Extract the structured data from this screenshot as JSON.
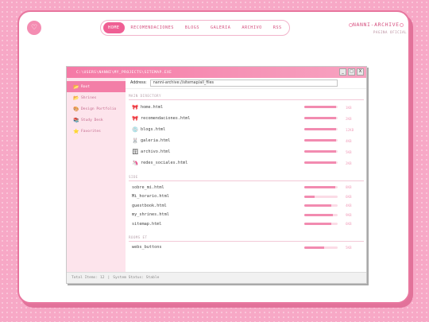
{
  "header": {
    "logo_glyph": "♡",
    "nav": [
      "HOME",
      "RECOMENDACIONES",
      "BLOGS",
      "GALERIA",
      "ARCHIVO",
      "RSS"
    ],
    "active_nav": "HOME",
    "site_title": "NANNI-ARCHIVE",
    "site_subtitle": "PAGINA OFICIAL"
  },
  "window": {
    "title_path": "C:\\USERS\\NANNI\\MY_PROJECTS\\SITEMAP.EXE",
    "buttons": [
      "_",
      "□",
      "X"
    ],
    "address_label": "Address:",
    "address_value": "nanni-archive://sitemap/all_files"
  },
  "sidebar": {
    "items": [
      {
        "icon": "📂",
        "label": "Root",
        "active": true
      },
      {
        "icon": "📂",
        "label": "Shrines",
        "active": false
      },
      {
        "icon": "🎨",
        "label": "Design Portfolio",
        "active": false
      },
      {
        "icon": "📚",
        "label": "Study Desk",
        "active": false
      },
      {
        "icon": "⭐",
        "label": "Favorites",
        "active": false
      }
    ]
  },
  "sections": [
    {
      "label": "MAIN DIRECTORY",
      "files": [
        {
          "icon": "🎀",
          "name": "home.html",
          "size": "1KB",
          "fill": 0.95
        },
        {
          "icon": "🎀",
          "name": "recomendaciones.html",
          "size": "2KB",
          "fill": 0.95
        },
        {
          "icon": "💿",
          "name": "blogs.html",
          "size": "12KB",
          "fill": 0.95
        },
        {
          "icon": "🐰",
          "name": "galeria.html",
          "size": "4KB",
          "fill": 0.95
        },
        {
          "icon": "🗄",
          "name": "archivo.html",
          "size": "5KB",
          "fill": 0.95
        },
        {
          "icon": "🦄",
          "name": "redes_sociales.html",
          "size": "2KB",
          "fill": 0.95
        }
      ]
    },
    {
      "label": "SIDE",
      "files": [
        {
          "icon": "",
          "name": "sobre_mi.html",
          "size": "8KB",
          "fill": 0.92
        },
        {
          "icon": "",
          "name": "Mi_horario.html",
          "size": "6KB",
          "fill": 0.3
        },
        {
          "icon": "",
          "name": "guestbook.html",
          "size": "4KB",
          "fill": 0.8
        },
        {
          "icon": "",
          "name": "my_shrines.html",
          "size": "9KB",
          "fill": 0.85
        },
        {
          "icon": "",
          "name": "sitemap.html",
          "size": "6KB",
          "fill": 0.8
        }
      ]
    },
    {
      "label": "ROOMS ET",
      "files": [
        {
          "icon": "",
          "name": "webs_buttons",
          "size": "5KB",
          "fill": 0.6
        }
      ]
    }
  ],
  "status": {
    "items": "Total Items: 12",
    "separator": "|",
    "system": "System Status: Stable"
  },
  "colors": {
    "accent": "#ef5f94",
    "background": "#f7a8c6",
    "sidebar": "#fde4ec"
  }
}
